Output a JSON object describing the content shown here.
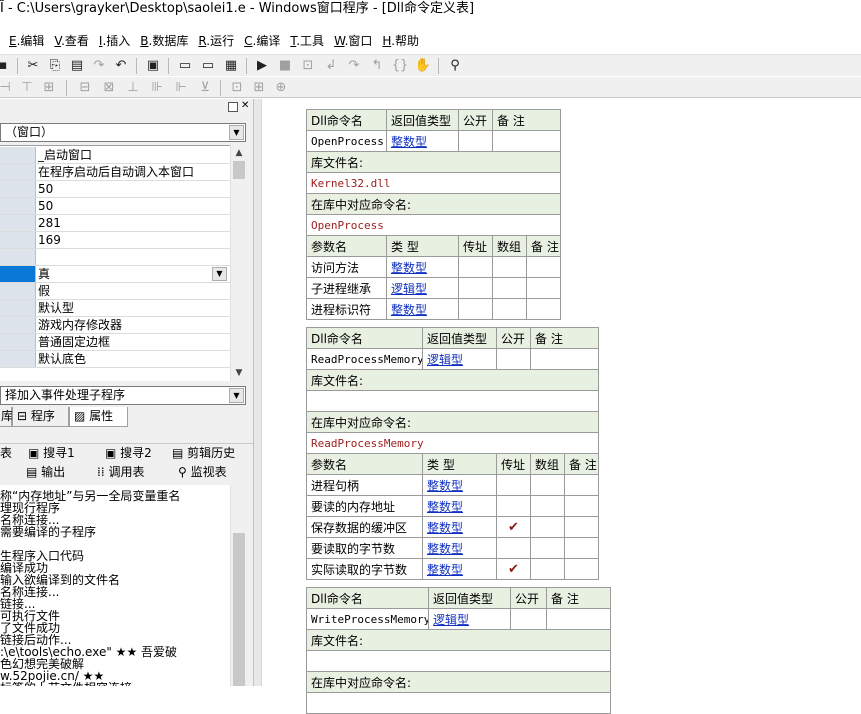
{
  "title": "Ĩ - C:\\Users\\grayker\\Desktop\\saolei1.e - Windows窗口程序 - [Dll命令定义表]",
  "menu": [
    {
      "key": "E",
      "label": "E.编辑"
    },
    {
      "key": "V",
      "label": "V.查看"
    },
    {
      "key": "I",
      "label": "I.插入"
    },
    {
      "key": "B",
      "label": "B.数据库"
    },
    {
      "key": "R",
      "label": "R.运行"
    },
    {
      "key": "C",
      "label": "C.编译"
    },
    {
      "key": "T",
      "label": "T.工具"
    },
    {
      "key": "W",
      "label": "W.窗口"
    },
    {
      "key": "H",
      "label": "H.帮助"
    }
  ],
  "left_panel": {
    "object_combo": "（窗口）",
    "properties": [
      {
        "value": "_启动窗口",
        "selected": false
      },
      {
        "value": "在程序启动后自动调入本窗口",
        "selected": false
      },
      {
        "value": "50",
        "selected": false
      },
      {
        "value": "50",
        "selected": false
      },
      {
        "value": "281",
        "selected": false
      },
      {
        "value": "169",
        "selected": false
      },
      {
        "value": "",
        "selected": false
      },
      {
        "value": "真",
        "selected": true
      },
      {
        "value": "假",
        "selected": false
      },
      {
        "value": "默认型",
        "selected": false
      },
      {
        "value": "游戏内存修改器",
        "selected": false
      },
      {
        "value": "普通固定边框",
        "selected": false
      },
      {
        "value": "默认底色",
        "selected": false
      }
    ],
    "event_combo": "择加入事件处理子程序",
    "tabs": [
      {
        "label": "库",
        "active": false
      },
      {
        "label": "程序",
        "active": false
      },
      {
        "label": "属性",
        "active": true
      }
    ],
    "output_tabs_row1": [
      {
        "label": "表"
      },
      {
        "label": "搜寻1"
      },
      {
        "label": "搜寻2"
      },
      {
        "label": "剪辑历史"
      }
    ],
    "output_tabs_row2": [
      {
        "label": "输出"
      },
      {
        "label": "调用表"
      },
      {
        "label": "监视表"
      }
    ],
    "output_lines": [
      "称“内存地址”与另一全局变量重名",
      "理现行程序",
      "名称连接...",
      "需要编译的子程序",
      "",
      "生程序入口代码",
      "编译成功",
      "输入欲编译到的文件名",
      "名称连接...",
      "链接...",
      "可执行文件",
      "了文件成功",
      "链接后动作...",
      ":\\e\\tools\\echo.exe\"  ★★         吾爱破",
      "色幻想完美破解",
      "w.52pojie.cn/          ★★",
      "标签的上节文件相容连接"
    ]
  },
  "editor": {
    "hdr_dllname": "Dll命令名",
    "hdr_rettype": "返回值类型",
    "hdr_public": "公开",
    "hdr_note": "备 注",
    "lbl_libfile": "库文件名:",
    "lbl_libcmd": "在库中对应命令名:",
    "hdr_param": "参数名",
    "hdr_type": "类 型",
    "hdr_byref": "传址",
    "hdr_array": "数组",
    "check_mark": "✔",
    "dlls": [
      {
        "name": "OpenProcess",
        "return_type": "整数型",
        "lib_file": "Kernel32.dll",
        "lib_cmd": "OpenProcess",
        "params": [
          {
            "name": "访问方法",
            "type": "整数型",
            "byref": false
          },
          {
            "name": "子进程继承",
            "type": "逻辑型",
            "byref": false
          },
          {
            "name": "进程标识符",
            "type": "整数型",
            "byref": false
          }
        ]
      },
      {
        "name": "ReadProcessMemory",
        "return_type": "逻辑型",
        "lib_file": "",
        "lib_cmd": "ReadProcessMemory",
        "params": [
          {
            "name": "进程句柄",
            "type": "整数型",
            "byref": false
          },
          {
            "name": "要读的内存地址",
            "type": "整数型",
            "byref": false
          },
          {
            "name": "保存数据的缓冲区",
            "type": "整数型",
            "byref": true
          },
          {
            "name": "要读取的字节数",
            "type": "整数型",
            "byref": false
          },
          {
            "name": "实际读取的字节数",
            "type": "整数型",
            "byref": true
          }
        ]
      },
      {
        "name": "WriteProcessMemory",
        "return_type": "逻辑型",
        "lib_file": "",
        "lib_cmd": "",
        "params": []
      }
    ]
  }
}
